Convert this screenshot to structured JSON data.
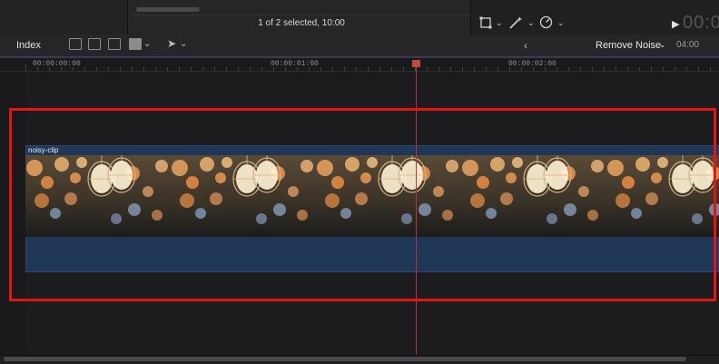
{
  "viewer": {
    "selection_status": "1 of 2 selected, 10:00",
    "timecode": "00:00"
  },
  "toolbar": {
    "index_label": "Index",
    "effect_name": "Remove Noise",
    "duration": "04:00"
  },
  "ruler": {
    "labels": [
      "00:00:00:00",
      "00:00:01:00",
      "00:00:02:00"
    ]
  },
  "timeline": {
    "clip_name": "noisy-clip"
  },
  "icons": {
    "transform": "crop-icon",
    "enhance": "magic-wand-icon",
    "retime": "speedometer-icon",
    "play": "play-icon",
    "select_tool": "arrow-cursor-icon"
  },
  "colors": {
    "highlight": "#e31414",
    "clip_fill": "#1f3656",
    "playhead": "#b13b3b"
  }
}
